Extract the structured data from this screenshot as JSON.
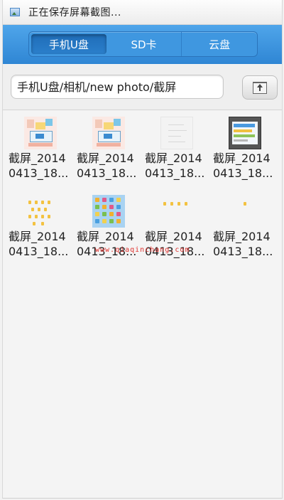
{
  "status_bar": {
    "icon": "picture-icon",
    "text": "正在保存屏幕截图..."
  },
  "tabs": [
    {
      "label": "手机U盘",
      "active": true
    },
    {
      "label": "SD卡",
      "active": false
    },
    {
      "label": "云盘",
      "active": false
    }
  ],
  "path": {
    "value": "手机U盘/相机/new photo/截屏",
    "upload_icon": "upload-folder-icon"
  },
  "files": [
    {
      "name_line1": "截屏_2014",
      "name_line2": "0413_18..."
    },
    {
      "name_line1": "截屏_2014",
      "name_line2": "0413_18..."
    },
    {
      "name_line1": "截屏_2014",
      "name_line2": "0413_18..."
    },
    {
      "name_line1": "截屏_2014",
      "name_line2": "0413_18..."
    },
    {
      "name_line1": "截屏_2014",
      "name_line2": "0413_18..."
    },
    {
      "name_line1": "截屏_2014",
      "name_line2": "0413_18..."
    },
    {
      "name_line1": "截屏_2014",
      "name_line2": "0413_18..."
    },
    {
      "name_line1": "截屏_2014",
      "name_line2": "0413_18..."
    }
  ],
  "watermark": "www.qiaqinchang.com",
  "colors": {
    "header_blue": "#3a93df",
    "active_tab": "#1f6db8",
    "watermark_red": "#e0322e"
  }
}
